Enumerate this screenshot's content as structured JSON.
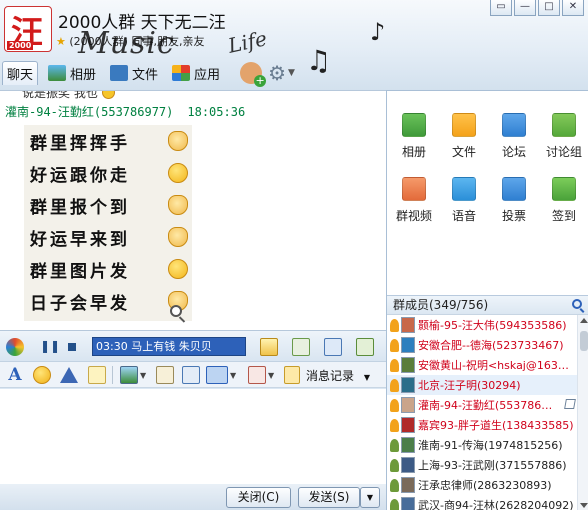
{
  "window": {
    "title": "2000人群 天下无二汪",
    "subtitle": "(2000人群) 同事,朋友,亲友",
    "logo_text": "汪",
    "logo_badge": "2000",
    "decoration": {
      "music": "Music",
      "life": "Life"
    }
  },
  "window_controls": {
    "menu": "▭",
    "minimize": "—",
    "maximize": "□",
    "close": "✕"
  },
  "tabs": [
    {
      "label": "聊天",
      "icon": "chat-icon"
    },
    {
      "label": "相册",
      "icon": "photo-icon"
    },
    {
      "label": "文件",
      "icon": "file-icon"
    },
    {
      "label": "应用",
      "icon": "app-icon"
    }
  ],
  "chat": {
    "previous_message": "说是振奖 我也",
    "sender": "灌南-94-汪勤红(553786977)",
    "time": "18:05:36",
    "lines": [
      "群里挥挥手",
      "好运跟你走",
      "群里报个到",
      "好运早来到",
      "群里图片发",
      "日子会早发"
    ]
  },
  "music_bar": {
    "now_playing": "03:30 马上有钱  朱贝贝"
  },
  "format_bar": {
    "record_label": "消息记录"
  },
  "buttons": {
    "close": "关闭(C)",
    "send": "发送(S)"
  },
  "apps": [
    {
      "label": "相册",
      "color": "#3f9a3a"
    },
    {
      "label": "文件",
      "color": "#f4a21a"
    },
    {
      "label": "论坛",
      "color": "#2f7fd1"
    },
    {
      "label": "讨论组",
      "color": "#55a83a"
    },
    {
      "label": "群视频",
      "color": "#e36a3a"
    },
    {
      "label": "语音",
      "color": "#2b8fd8"
    },
    {
      "label": "投票",
      "color": "#2f7fd1"
    },
    {
      "label": "签到",
      "color": "#4aa23a"
    }
  ],
  "members_header": "群成员(349/756)",
  "members": [
    {
      "name": "颢榆-95-汪大伟(594353586)",
      "color": "#d0021b",
      "avatar": "#c8684a"
    },
    {
      "name": "安徽合肥--德海(523733467)",
      "color": "#d0021b",
      "avatar": "#2d7fbe"
    },
    {
      "name": "安徽黄山-祝明<hskaj@163…",
      "color": "#d0021b",
      "avatar": "#5a7d3a"
    },
    {
      "name": "北京-汪子明(30294)",
      "color": "#d0021b",
      "avatar": "#2a6e8a",
      "selected": true
    },
    {
      "name": "灌南-94-汪勤红(553786…",
      "color": "#d0021b",
      "avatar": "#caa48a",
      "editable": true
    },
    {
      "name": "嘉宾93-胖子道生(138433585)",
      "color": "#d0021b",
      "avatar": "#b02a2a"
    },
    {
      "name": "淮南-91-传海(1974815256)",
      "color": "#222222",
      "avatar": "#4b7e4a"
    },
    {
      "name": "上海-93-汪武刚(371557886)",
      "color": "#222222",
      "avatar": "#3d5b86"
    },
    {
      "name": "汪承忠律师(2863230893)",
      "color": "#222222",
      "avatar": "#7a6a5a"
    },
    {
      "name": "武汉-商94-汪林(2628204092)",
      "color": "#222222",
      "avatar": "#486d9a"
    }
  ]
}
